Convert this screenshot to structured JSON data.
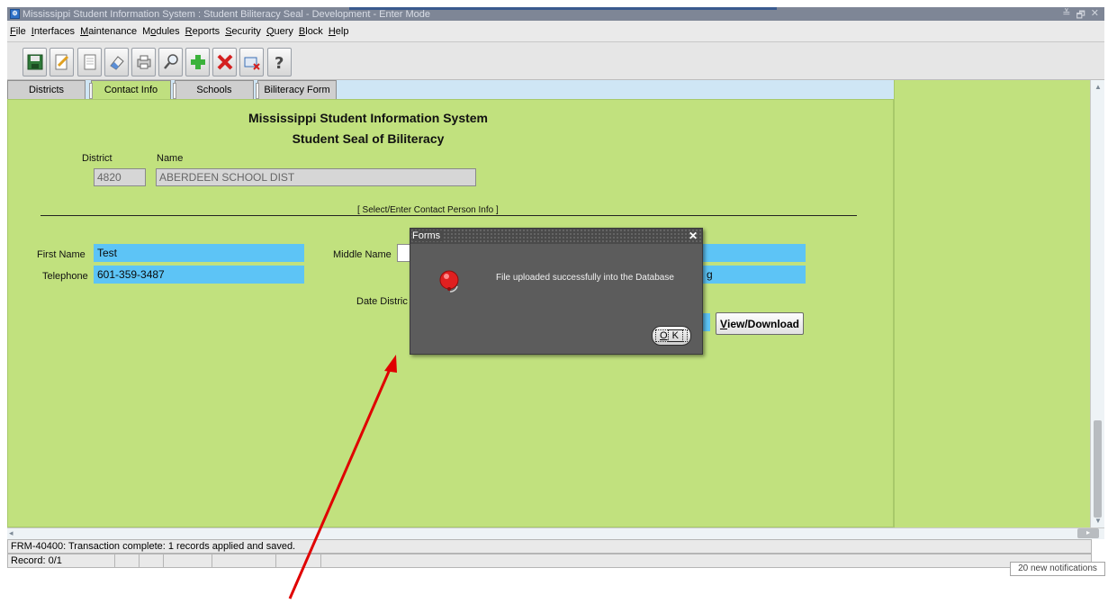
{
  "window": {
    "title": "Mississippi Student Information System : Student Biliteracy Seal  -  Development  -  Enter Mode",
    "buttons": [
      "≚",
      "🗗",
      "✕"
    ]
  },
  "menu": [
    {
      "prefix": "",
      "key": "F",
      "rest": "ile"
    },
    {
      "prefix": "",
      "key": "I",
      "rest": "nterfaces"
    },
    {
      "prefix": "",
      "key": "M",
      "rest": "aintenance"
    },
    {
      "prefix": "M",
      "key": "o",
      "rest": "dules"
    },
    {
      "prefix": "",
      "key": "R",
      "rest": "eports"
    },
    {
      "prefix": "",
      "key": "S",
      "rest": "ecurity"
    },
    {
      "prefix": "",
      "key": "Q",
      "rest": "uery"
    },
    {
      "prefix": "",
      "key": "B",
      "rest": "lock"
    },
    {
      "prefix": "",
      "key": "H",
      "rest": "elp"
    }
  ],
  "toolbar": {
    "icons": [
      "save-icon",
      "edit-document-icon",
      "blank-page-icon",
      "eraser-icon",
      "print-icon",
      "search-icon",
      "add-record-icon",
      "delete-record-icon",
      "clear-icon",
      "help-icon"
    ]
  },
  "tabs": {
    "districts": "Districts",
    "contact_info": "Contact Info",
    "schools": "Schools",
    "biliteracy_form": "Biliteracy Form"
  },
  "form": {
    "title1": "Mississippi Student Information System",
    "title2": "Student Seal of Biliteracy",
    "district_label": "District",
    "name_label": "Name",
    "district_value": "4820",
    "name_value": "ABERDEEN SCHOOL DIST",
    "section": "[ Select/Enter Contact Person Info ]",
    "first_name_label": "First Name",
    "first_name_value": "Test",
    "middle_name_label": "Middle Name",
    "telephone_label": "Telephone",
    "telephone_value": "601-359-3487",
    "date_district_label": "Date Distric",
    "partial_value": "g",
    "view_download_key": "V",
    "view_download_rest": "iew/Download"
  },
  "dialog": {
    "title": "Forms",
    "message": "File uploaded successfully into the Database",
    "ok_key": "O",
    "ok_rest": "K"
  },
  "status": {
    "message": "FRM-40400: Transaction complete: 1 records applied and saved.",
    "record": "Record: 0/1"
  },
  "notification": "20 new notifications",
  "colors": {
    "form_bg": "#c1e17e",
    "field_highlight": "#5dc4f6",
    "dialog_bg": "#5c5c5c",
    "annotation_arrow": "#e00000"
  }
}
